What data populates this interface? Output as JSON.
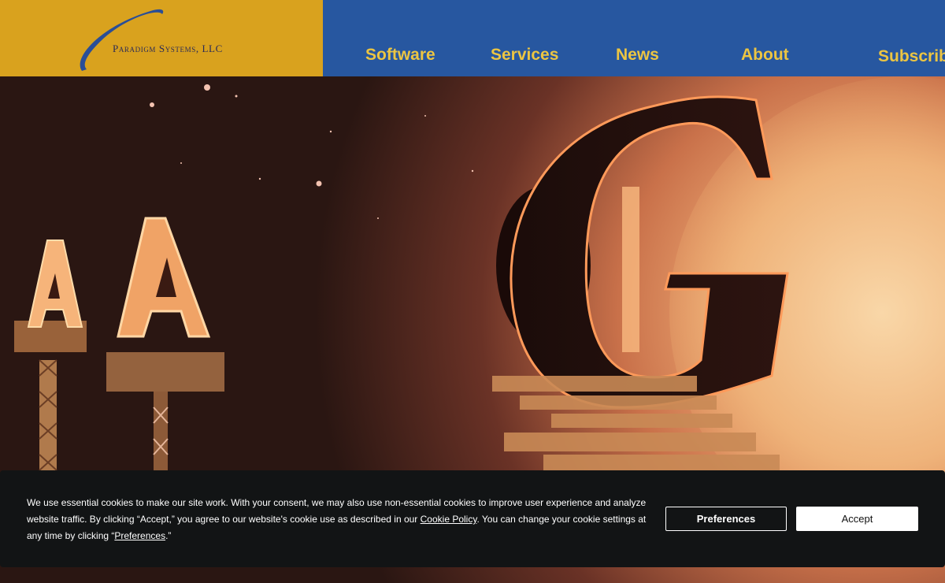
{
  "logo": {
    "text": "Paradigm Systems, LLC",
    "icon": "swoosh-logo-icon",
    "background_color": "#d9a21e"
  },
  "nav": {
    "background_color": "#2757a0",
    "text_color": "#ecc542",
    "items": [
      {
        "label": "Software"
      },
      {
        "label": "Services"
      },
      {
        "label": "News"
      },
      {
        "label": "About"
      },
      {
        "label": "Subscribe"
      }
    ]
  },
  "hero": {
    "image": "hero-sun-letters-image"
  },
  "cookie_banner": {
    "text_part1": "We use essential cookies to make our site work. With your consent, we may also use non-essential cookies to improve user experience and analyze website traffic. By clicking “Accept,” you agree to our website's cookie use as described in our ",
    "cookie_policy_link": "Cookie Policy",
    "text_part2": ". You can change your cookie settings at any time by clicking “",
    "preferences_link": "Preferences",
    "text_part3": ".”",
    "preferences_button": "Preferences",
    "accept_button": "Accept"
  }
}
